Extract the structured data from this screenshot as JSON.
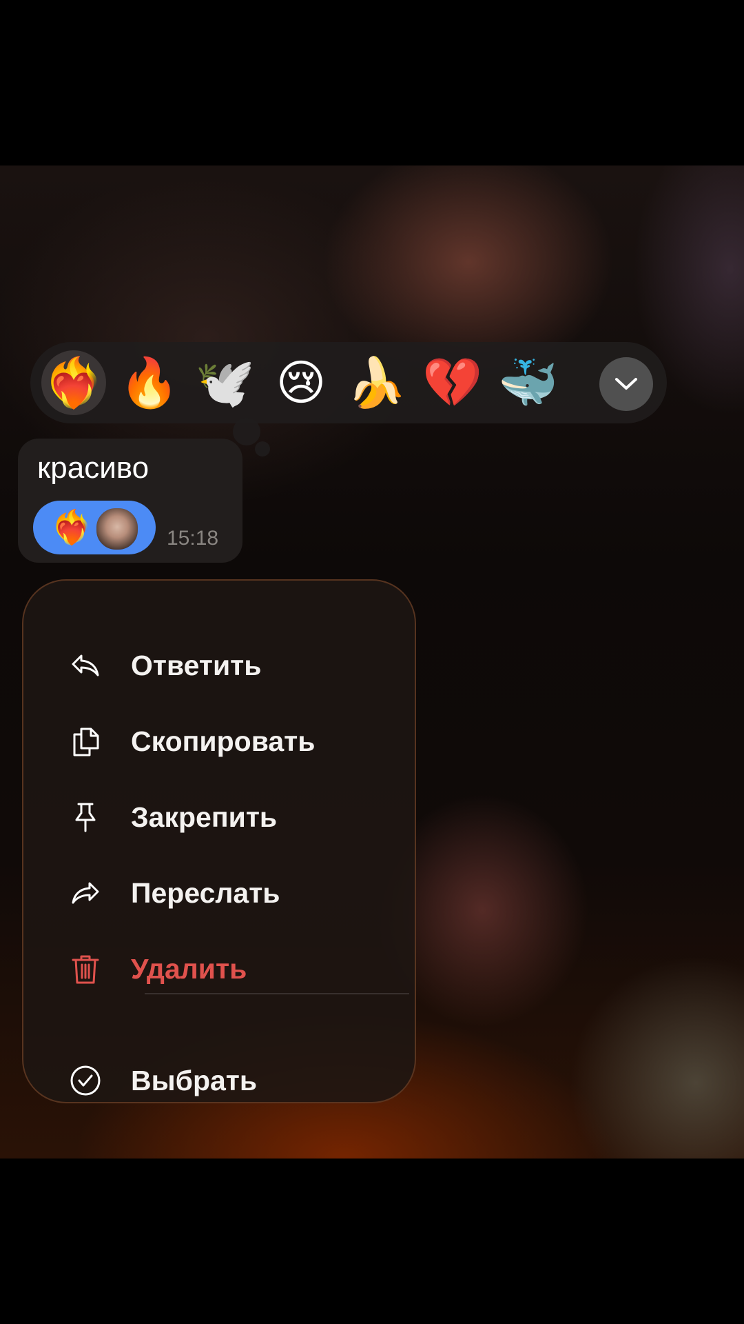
{
  "reactions": {
    "emojis": [
      "❤️‍🔥",
      "🔥",
      "🕊️",
      "😢",
      "🍌",
      "💔",
      "🐳"
    ],
    "active_index": 0
  },
  "message": {
    "text": "красиво",
    "time": "15:18",
    "reaction_emoji": "❤️‍🔥"
  },
  "menu": {
    "items": [
      {
        "label": "Ответить",
        "icon": "reply-icon"
      },
      {
        "label": "Скопировать",
        "icon": "copy-icon"
      },
      {
        "label": "Закрепить",
        "icon": "pin-icon"
      },
      {
        "label": "Переслать",
        "icon": "forward-icon"
      },
      {
        "label": "Удалить",
        "icon": "trash-icon"
      },
      {
        "label": "Выбрать",
        "icon": "check-circle-icon"
      }
    ]
  },
  "colors": {
    "danger": "#e0524d",
    "reaction_chip": "#4c8bf5"
  }
}
